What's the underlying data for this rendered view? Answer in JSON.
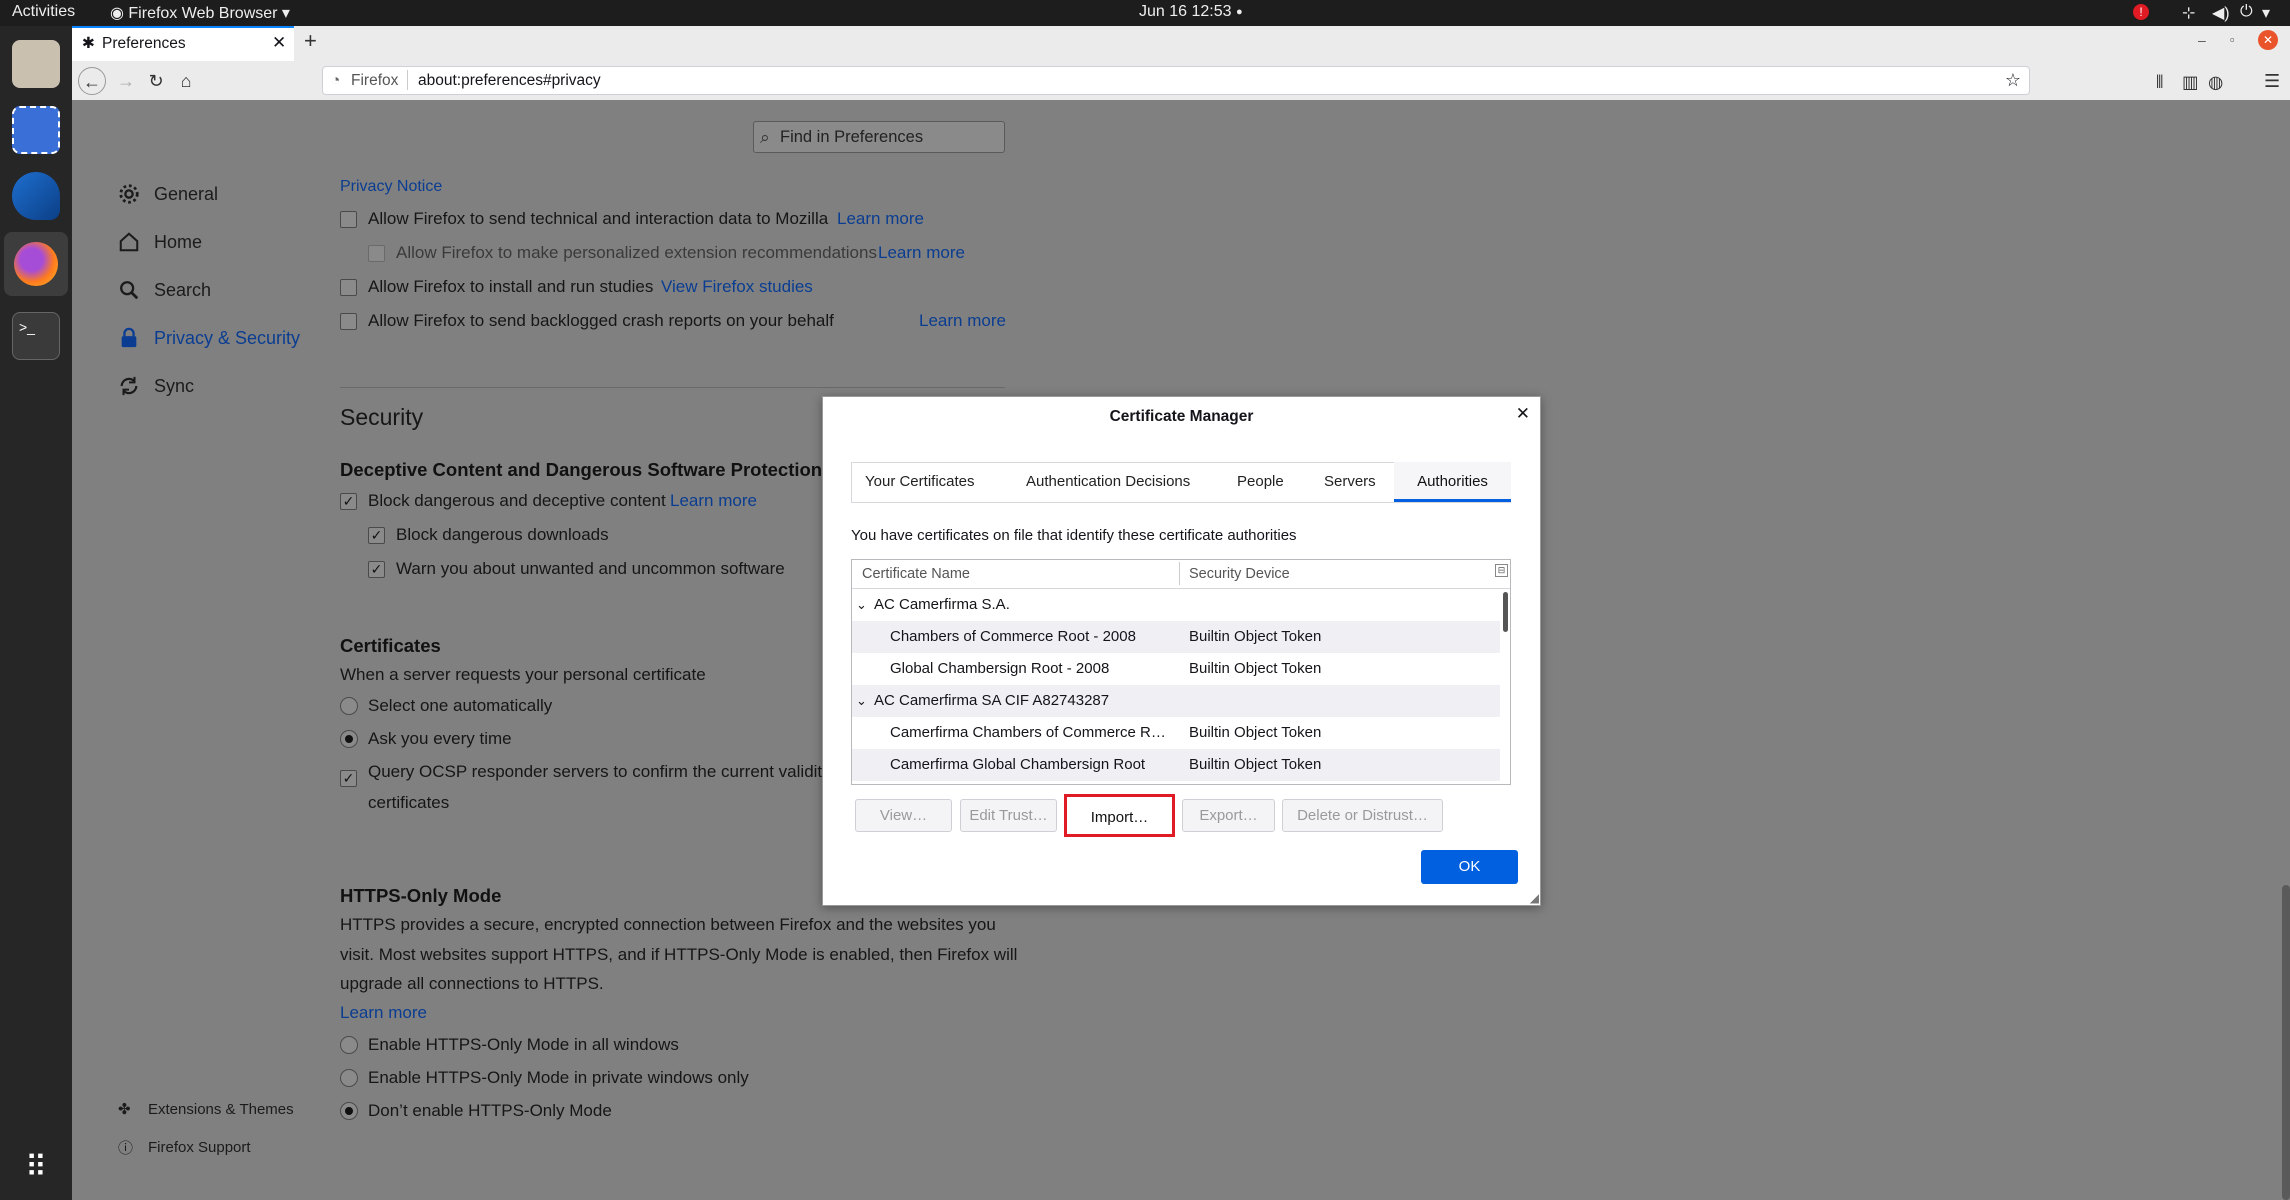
{
  "topbar": {
    "activities": "Activities",
    "app_menu": "Firefox Web Browser ▾",
    "clock": "Jun 16  12:53"
  },
  "browser": {
    "tab_title": "Preferences",
    "url_identity": "Firefox",
    "url": "about:preferences#privacy"
  },
  "search": {
    "placeholder": "Find in Preferences"
  },
  "sidebar": {
    "items": [
      {
        "label": "General",
        "icon": "gear-icon"
      },
      {
        "label": "Home",
        "icon": "home-icon"
      },
      {
        "label": "Search",
        "icon": "search-icon"
      },
      {
        "label": "Privacy & Security",
        "icon": "lock-icon"
      },
      {
        "label": "Sync",
        "icon": "sync-icon"
      }
    ],
    "footer": [
      {
        "label": "Extensions & Themes",
        "icon": "puzzle-icon"
      },
      {
        "label": "Firefox Support",
        "icon": "help-icon"
      }
    ]
  },
  "data_collection": {
    "privacy_notice": "Privacy Notice",
    "technical": "Allow Firefox to send technical and interaction data to Mozilla",
    "technical_link": "Learn more",
    "personalized": "Allow Firefox to make personalized extension recommendations",
    "personalized_link": "Learn more",
    "studies": "Allow Firefox to install and run studies",
    "studies_link": "View Firefox studies",
    "crash": "Allow Firefox to send backlogged crash reports on your behalf",
    "crash_link": "Learn more"
  },
  "security": {
    "heading": "Security",
    "deceptive_heading": "Deceptive Content and Dangerous Software Protection",
    "block_deceptive": "Block dangerous and deceptive content",
    "block_deceptive_link": "Learn more",
    "block_downloads": "Block dangerous downloads",
    "warn_software": "Warn you about unwanted and uncommon software"
  },
  "certificates": {
    "heading": "Certificates",
    "prompt": "When a server requests your personal certificate",
    "select_auto": "Select one automatically",
    "ask_every": "Ask you every time",
    "ocsp": "Query OCSP responder servers to confirm the current validity of",
    "ocsp_line2": "certificates"
  },
  "https": {
    "heading": "HTTPS-Only Mode",
    "desc1": "HTTPS provides a secure, encrypted connection between Firefox and the websites you",
    "desc2": "visit. Most websites support HTTPS, and if HTTPS-Only Mode is enabled, then Firefox will",
    "desc3": "upgrade all connections to HTTPS.",
    "learn_more": "Learn more",
    "opt_all": "Enable HTTPS-Only Mode in all windows",
    "opt_private": "Enable HTTPS-Only Mode in private windows only",
    "opt_off": "Don’t enable HTTPS-Only Mode"
  },
  "dialog": {
    "title": "Certificate Manager",
    "tabs": [
      "Your Certificates",
      "Authentication Decisions",
      "People",
      "Servers",
      "Authorities"
    ],
    "selected_tab": "Authorities",
    "description": "You have certificates on file that identify these certificate authorities",
    "columns": [
      "Certificate Name",
      "Security Device"
    ],
    "rows": [
      {
        "name": "AC Camerfirma S.A.",
        "device": "",
        "group": true
      },
      {
        "name": "Chambers of Commerce Root - 2008",
        "device": "Builtin Object Token",
        "group": false
      },
      {
        "name": "Global Chambersign Root - 2008",
        "device": "Builtin Object Token",
        "group": false
      },
      {
        "name": "AC Camerfirma SA CIF A82743287",
        "device": "",
        "group": true
      },
      {
        "name": "Camerfirma Chambers of Commerce R…",
        "device": "Builtin Object Token",
        "group": false
      },
      {
        "name": "Camerfirma Global Chambersign Root",
        "device": "Builtin Object Token",
        "group": false
      }
    ],
    "buttons": {
      "view": "View…",
      "edit_trust": "Edit Trust…",
      "import": "Import…",
      "export": "Export…",
      "delete": "Delete or Distrust…",
      "ok": "OK"
    },
    "highlight_color": "#e01b24",
    "accent": "#0060df"
  }
}
